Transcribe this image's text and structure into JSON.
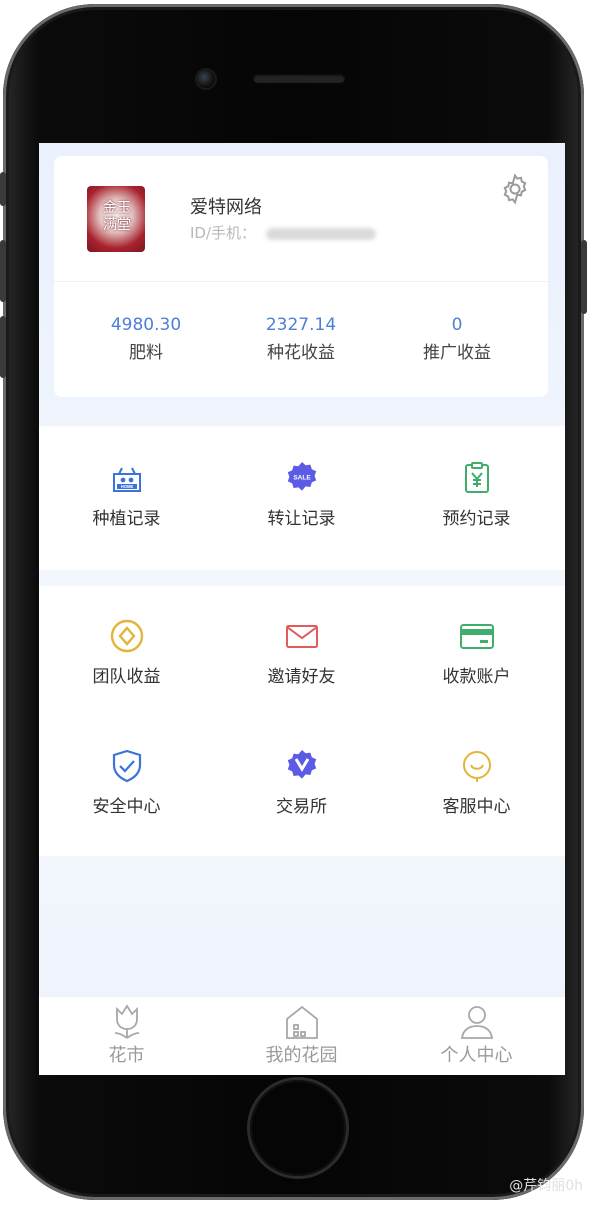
{
  "profile": {
    "username": "爱特网络",
    "id_label": "ID/手机：",
    "avatar_text": "金玉满堂"
  },
  "stats": [
    {
      "value": "4980.30",
      "label": "肥料"
    },
    {
      "value": "2327.14",
      "label": "种花收益"
    },
    {
      "value": "0",
      "label": "推广收益"
    }
  ],
  "records": [
    {
      "label": "种植记录",
      "icon": "home-basket-icon"
    },
    {
      "label": "转让记录",
      "icon": "sale-badge-icon"
    },
    {
      "label": "预约记录",
      "icon": "clipboard-yen-icon"
    }
  ],
  "services": [
    {
      "label": "团队收益",
      "icon": "coin-icon"
    },
    {
      "label": "邀请好友",
      "icon": "mail-icon"
    },
    {
      "label": "收款账户",
      "icon": "card-icon"
    },
    {
      "label": "安全中心",
      "icon": "shield-icon"
    },
    {
      "label": "交易所",
      "icon": "exchange-badge-icon"
    },
    {
      "label": "客服中心",
      "icon": "smile-icon"
    }
  ],
  "tabbar": [
    {
      "label": "花市",
      "icon": "tulip-icon"
    },
    {
      "label": "我的花园",
      "icon": "house-icon"
    },
    {
      "label": "个人中心",
      "icon": "person-icon"
    }
  ],
  "watermark": "@芹钧丽0h",
  "colors": {
    "accent_blue": "#4d7fd7",
    "coin_gold": "#e2b43a",
    "mail_red": "#e25b5b",
    "card_green": "#3fae6b",
    "shield_blue": "#3b73d8",
    "badge_purple": "#5b5be6"
  }
}
